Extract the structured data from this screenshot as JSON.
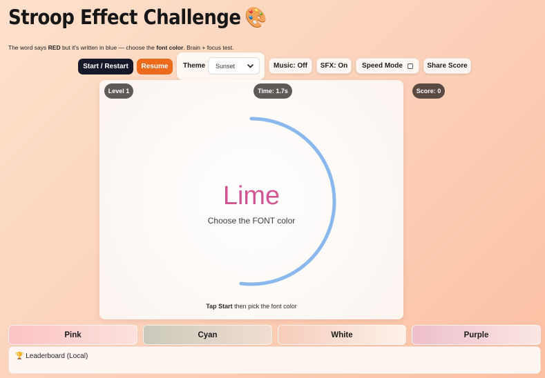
{
  "app": {
    "title": "Stroop Effect Challenge",
    "title_icon": "🎨",
    "subtitle": {
      "part1": "The word says ",
      "red_word": "RED",
      "part2": " but it's written in blue — choose the ",
      "font_color": "font color",
      "part3": ". Brain + focus test."
    }
  },
  "controls": {
    "start_label": "Start / Restart",
    "resume_label": "Resume",
    "theme_label": "Theme",
    "theme_value": "Sunset",
    "music_label": "Music: Off",
    "sfx_label": "SFX: On",
    "speed_label": "Speed Mode",
    "share_label": "Share Score"
  },
  "status": {
    "level": "Level 1",
    "time": "Time: 1.7s",
    "score": "Score: 0",
    "timer_fraction": 0.52
  },
  "game": {
    "word": "Lime",
    "word_color": "#d05592",
    "prompt": "Choose the FONT color",
    "hint": {
      "part1": "Tap Start",
      "part2": " then pick the ",
      "part3": "font color"
    }
  },
  "choices": [
    "Pink",
    "Cyan",
    "White",
    "Purple"
  ],
  "leaderboard": {
    "icon": "🏆",
    "title": "Leaderboard (Local)"
  },
  "colors": {
    "ring": "#8ab8ec",
    "start_button": "#15192a",
    "resume_button": "#ec6a1b",
    "pill": "#5e5a58"
  }
}
